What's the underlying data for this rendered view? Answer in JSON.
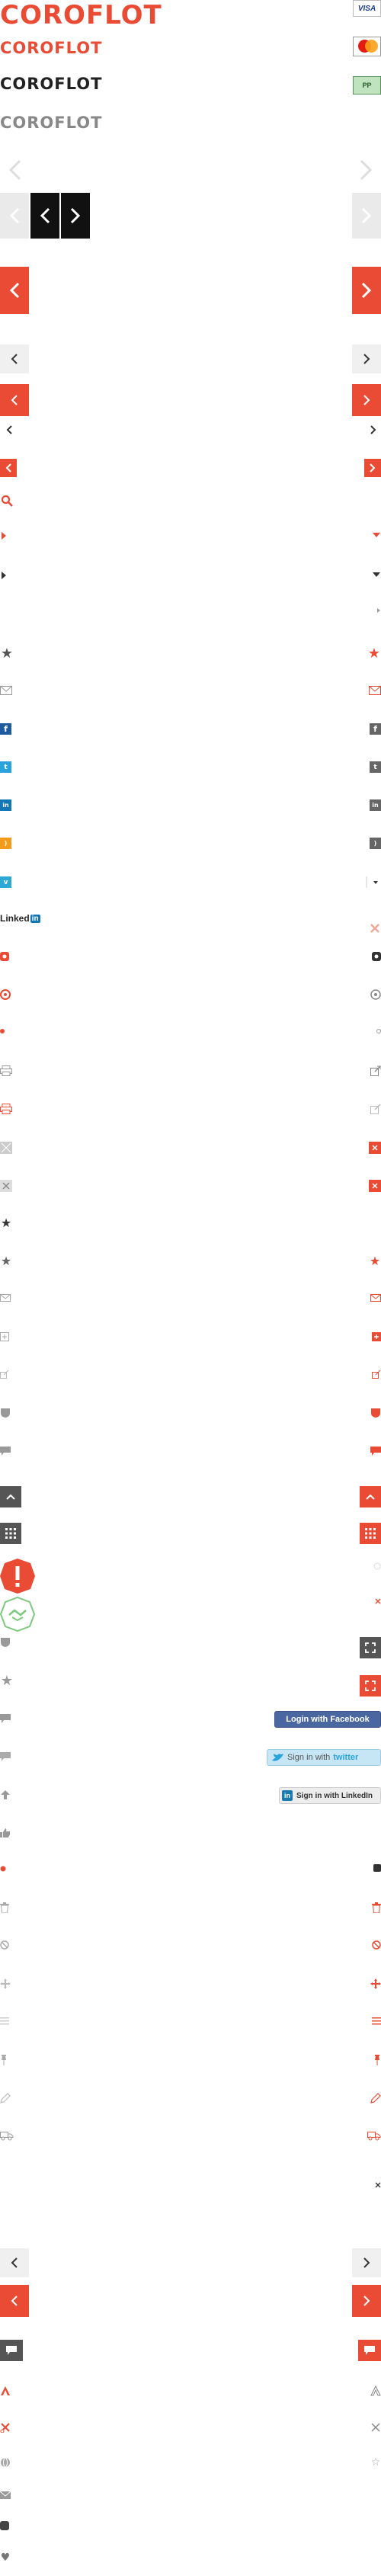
{
  "brand": {
    "logo_text": "COROFLOT",
    "red": "#e94b35",
    "dark": "#111111",
    "gray": "#555555"
  },
  "payment": {
    "visa": "VISA",
    "mastercard": "MasterCard",
    "paypal": "PP"
  },
  "arrows": {
    "left": "‹",
    "right": "›"
  },
  "linkedin_logo": {
    "text": "Linked",
    "in": "in"
  },
  "social_buttons": {
    "facebook_label": "Login with Facebook",
    "twitter_prefix": "Sign in with",
    "twitter_brand": "twitter",
    "linkedin_label": "Sign in with LinkedIn",
    "facebook_color": "#4a67a1",
    "twitter_color": "#c7e6f5",
    "linkedin_color": "#1a7bb1"
  },
  "icons": [
    "chevron-left-outline-icon",
    "chevron-right-outline-icon",
    "search-icon",
    "triangle-right-icon",
    "triangle-down-icon",
    "star-icon",
    "mail-icon",
    "facebook-icon",
    "twitter-icon",
    "linkedin-icon",
    "rss-icon",
    "vimeo-icon",
    "close-x-icon",
    "instagram-icon",
    "dribbble-icon",
    "dot-icon",
    "print-icon",
    "external-link-icon",
    "grid-icon",
    "exclamation-icon",
    "handshake-icon",
    "expand-icon",
    "comment-icon",
    "thumbs-up-icon",
    "trash-icon",
    "block-icon",
    "move-icon",
    "list-icon",
    "pin-icon",
    "pencil-icon",
    "truck-icon",
    "chat-icon",
    "text-a-icon",
    "globe-icon",
    "heart-icon"
  ]
}
